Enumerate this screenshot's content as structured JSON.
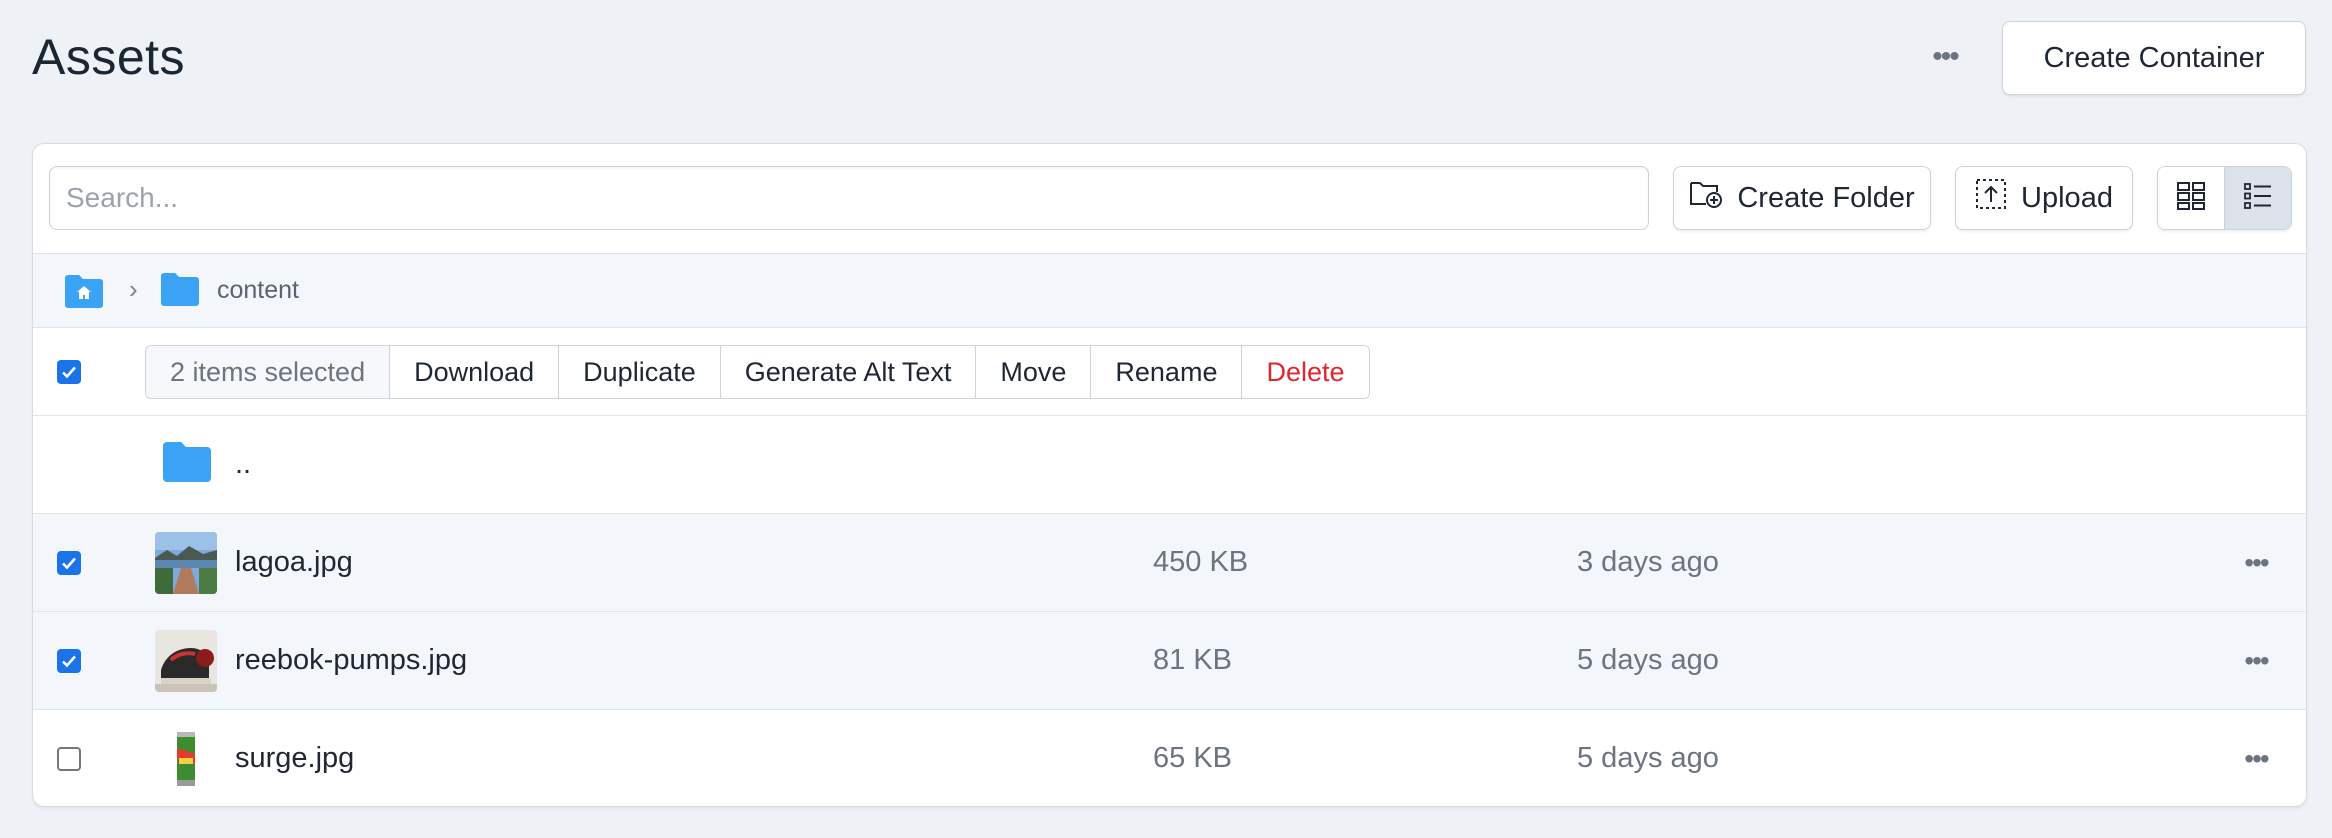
{
  "header": {
    "title": "Assets",
    "more_icon": "more-horizontal-icon",
    "create_container_label": "Create Container"
  },
  "toolbar": {
    "search_placeholder": "Search...",
    "search_value": "",
    "create_folder_label": "Create Folder",
    "create_folder_icon": "folder-add-icon",
    "upload_label": "Upload",
    "upload_icon": "upload-icon",
    "view_modes": [
      {
        "name": "grid",
        "icon": "grid-view-icon",
        "active": false
      },
      {
        "name": "list",
        "icon": "list-view-icon",
        "active": true
      }
    ]
  },
  "breadcrumb": {
    "home_icon": "home-folder-icon",
    "separator": "›",
    "items": [
      {
        "label": "content",
        "icon": "folder-icon"
      }
    ]
  },
  "bulk_actions": {
    "select_all_checked": true,
    "selection_summary": "2 items selected",
    "buttons": [
      "Download",
      "Duplicate",
      "Generate Alt Text",
      "Move",
      "Rename",
      "Delete"
    ]
  },
  "parent_row": {
    "label": "..",
    "icon": "folder-icon"
  },
  "files": [
    {
      "name": "lagoa.jpg",
      "size": "450 KB",
      "modified": "3 days ago",
      "checked": true
    },
    {
      "name": "reebok-pumps.jpg",
      "size": "81 KB",
      "modified": "5 days ago",
      "checked": true
    },
    {
      "name": "surge.jpg",
      "size": "65 KB",
      "modified": "5 days ago",
      "checked": false
    }
  ],
  "colors": {
    "background": "#eef1f6",
    "accent": "#1a73e8",
    "folder": "#3aa3f5",
    "danger": "#e0262d",
    "muted_text": "#6b7480"
  }
}
